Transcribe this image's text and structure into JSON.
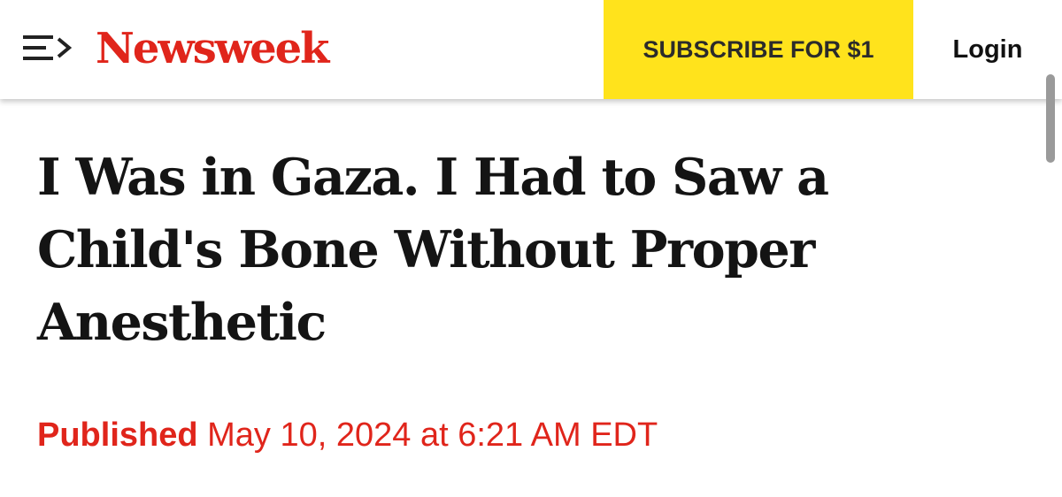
{
  "header": {
    "menu_icon": "menu-arrow-icon",
    "logo_text": "Newsweek",
    "subscribe_label": "SUBSCRIBE FOR $1",
    "login_label": "Login"
  },
  "article": {
    "headline": "I Was in Gaza. I Had to Saw a Child's Bone Without Proper Anesthetic",
    "published_label": "Published",
    "published_date": "May 10, 2024 at 6:21 AM EDT"
  },
  "colors": {
    "brand_red": "#e0251b",
    "subscribe_yellow": "#ffe31c",
    "text_dark": "#141414"
  }
}
